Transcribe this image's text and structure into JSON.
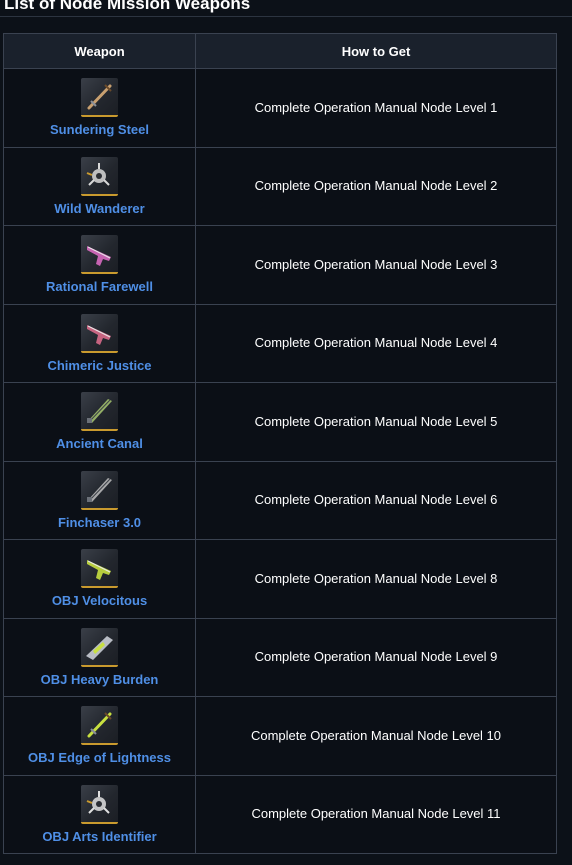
{
  "page": {
    "title": "List of Node Mission Weapons"
  },
  "table": {
    "headers": {
      "weapon": "Weapon",
      "how": "How to Get"
    },
    "rows": [
      {
        "weapon": "Sundering Steel",
        "how": "Complete Operation Manual Node Level 1",
        "icon": "sword-icon",
        "accent": "#c8a070"
      },
      {
        "weapon": "Wild Wanderer",
        "how": "Complete Operation Manual Node Level 2",
        "icon": "spiked-orb-icon",
        "accent": "#d8d8d8"
      },
      {
        "weapon": "Rational Farewell",
        "how": "Complete Operation Manual Node Level 3",
        "icon": "gun-icon",
        "accent": "#d86ac0"
      },
      {
        "weapon": "Chimeric Justice",
        "how": "Complete Operation Manual Node Level 4",
        "icon": "gun-icon",
        "accent": "#d86a8a"
      },
      {
        "weapon": "Ancient Canal",
        "how": "Complete Operation Manual Node Level 5",
        "icon": "blade-icon",
        "accent": "#a8c870"
      },
      {
        "weapon": "Finchaser 3.0",
        "how": "Complete Operation Manual Node Level 6",
        "icon": "blade-icon",
        "accent": "#c0c0c0"
      },
      {
        "weapon": "OBJ Velocitous",
        "how": "Complete Operation Manual Node Level 8",
        "icon": "gun-icon",
        "accent": "#c8e040"
      },
      {
        "weapon": "OBJ Heavy Burden",
        "how": "Complete Operation Manual Node Level 9",
        "icon": "greatsword-icon",
        "accent": "#c8e040"
      },
      {
        "weapon": "OBJ Edge of Lightness",
        "how": "Complete Operation Manual Node Level 10",
        "icon": "sword-icon",
        "accent": "#c8e040"
      },
      {
        "weapon": "OBJ Arts Identifier",
        "how": "Complete Operation Manual Node Level 11",
        "icon": "spiked-orb-icon",
        "accent": "#e0e0e0"
      }
    ]
  },
  "colors": {
    "background": "#0c1118",
    "link": "#4f8fe6",
    "border": "#3a4250",
    "header_bg": "#1a212c",
    "thumb_underline": "#c99a2e"
  }
}
